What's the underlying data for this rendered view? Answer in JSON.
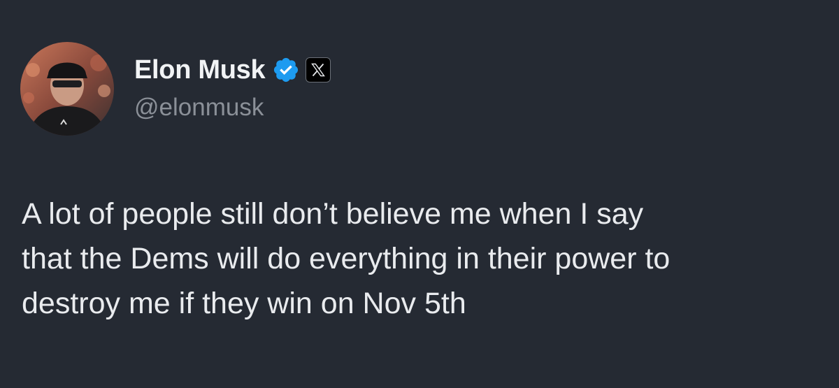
{
  "tweet": {
    "author": {
      "display_name": "Elon Musk",
      "handle": "@elonmusk",
      "verified": true,
      "verified_color": "#1d9bf0",
      "affiliate_badge_icon": "x-logo-icon"
    },
    "text_lines": [
      "A lot of people still don’t believe me when I say",
      "that the Dems will do everything in their power to",
      "destroy me if they win on Nov 5th"
    ]
  },
  "colors": {
    "background": "#252a33",
    "text": "#e9ebee",
    "handle": "#8b9098"
  }
}
